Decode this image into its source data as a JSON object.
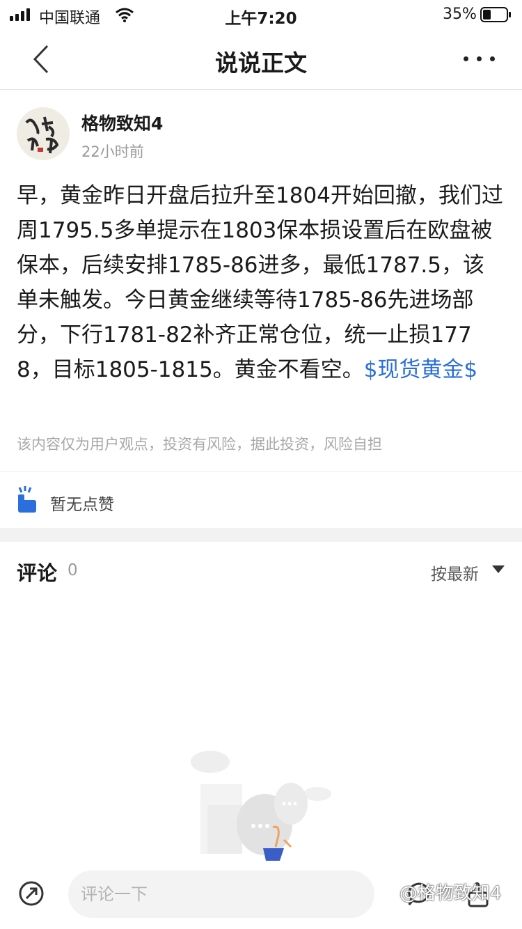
{
  "status_bar": {
    "carrier": "中国联通",
    "time": "上午7:20",
    "battery_percent": "35%",
    "battery_level": 0.35,
    "signal_bars": 4
  },
  "nav": {
    "title": "说说正文",
    "back_icon": "chevron-left-icon",
    "more_icon": "more-dots-icon"
  },
  "post": {
    "author": "格物致知4",
    "time_ago": "22小时前",
    "body": "早，黄金昨日开盘后拉升至1804开始回撤，我们过周1795.5多单提示在1803保本损设置后在欧盘被保本，后续安排1785-86进多，最低1787.5，该单未触发。今日黄金继续等待1785-86先进场部分，下行1781-82补齐正常仓位，统一止损1778，目标1805-1815。黄金不看空。",
    "tag": "$现货黄金$",
    "disclaimer": "该内容仅为用户观点，投资有风险，据此投资，风险自担"
  },
  "likes": {
    "text": "暂无点赞",
    "icon": "thumbs-up-icon",
    "accent_color": "#2a6fdb"
  },
  "comments": {
    "title": "评论",
    "count": "0",
    "sort_label": "按最新"
  },
  "bottom_bar": {
    "input_placeholder": "评论一下",
    "share_icon": "share-icon",
    "comment_icon": "comment-icon",
    "like_icon": "thumbs-up-outline-icon"
  },
  "watermark": "@格物致知4"
}
